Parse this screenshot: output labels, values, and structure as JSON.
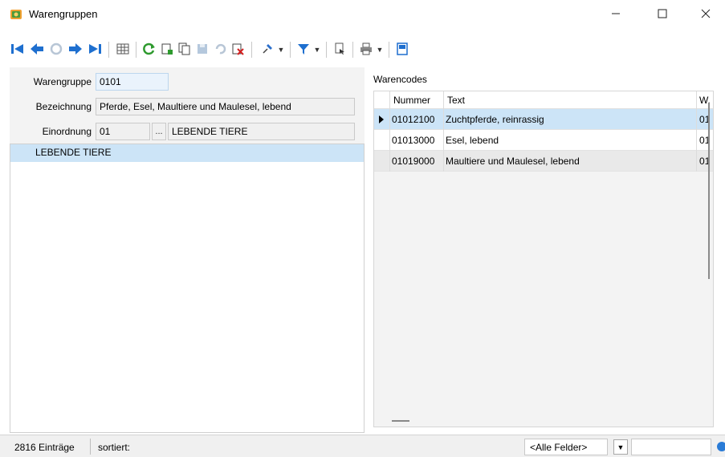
{
  "window": {
    "title": "Warengruppen"
  },
  "toolbar": {
    "buttons": [
      "first-record-icon",
      "prev-record-icon",
      "refresh-disabled-icon",
      "next-record-icon",
      "last-record-icon",
      "table-view-icon",
      "refresh-icon",
      "new-record-icon",
      "copy-record-icon",
      "save-icon",
      "undo-icon",
      "delete-icon",
      "pin-icon",
      "filter-icon",
      "document-icon",
      "print-icon",
      "layout-icon"
    ]
  },
  "form": {
    "warengruppe_label": "Warengruppe",
    "warengruppe_value": "0101",
    "bezeichnung_label": "Bezeichnung",
    "bezeichnung_value": "Pferde, Esel, Maultiere und Maulesel, lebend",
    "einordnung_label": "Einordnung",
    "einordnung_code": "01",
    "einordnung_dots": "...",
    "einordnung_text": "LEBENDE TIERE"
  },
  "tree": {
    "items": [
      "LEBENDE TIERE"
    ]
  },
  "warencodes": {
    "label": "Warencodes",
    "columns": [
      "Nummer",
      "Text",
      "W."
    ],
    "rows": [
      {
        "nummer": "01012100",
        "text": "Zuchtpferde, reinrassig",
        "w": "01"
      },
      {
        "nummer": "01013000",
        "text": "Esel, lebend",
        "w": "01"
      },
      {
        "nummer": "01019000",
        "text": "Maultiere und Maulesel, lebend",
        "w": "01"
      }
    ]
  },
  "status": {
    "count": "2816 Einträge",
    "sorted": "sortiert:",
    "filter_value": "<Alle Felder>"
  },
  "colors": {
    "selection": "#cce4f7",
    "accent": "#1a73c7"
  }
}
